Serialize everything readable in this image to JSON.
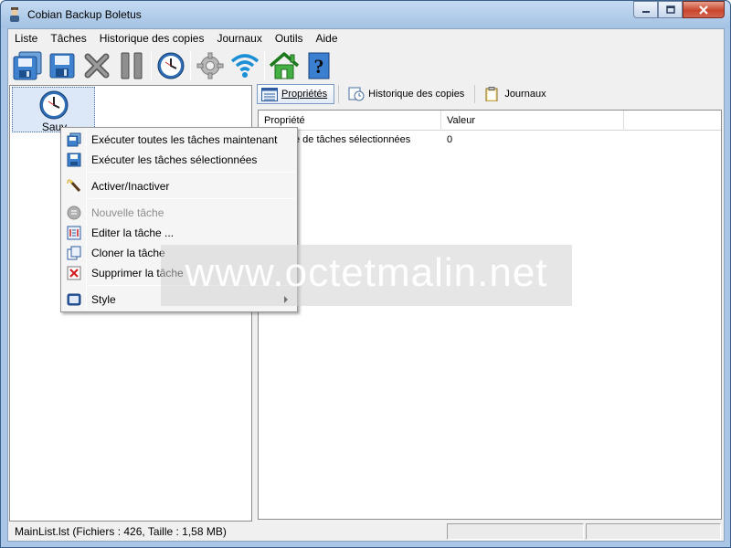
{
  "window": {
    "title": "Cobian Backup Boletus",
    "controls": [
      "minimize",
      "maximize",
      "close"
    ]
  },
  "menu": {
    "items": [
      "Liste",
      "Tâches",
      "Historique des copies",
      "Journaux",
      "Outils",
      "Aide"
    ]
  },
  "toolbar": {
    "buttons": [
      {
        "icon": "run-all-icon"
      },
      {
        "icon": "save-icon"
      },
      {
        "icon": "stop-icon"
      },
      {
        "icon": "pause-icon"
      },
      {
        "icon": "clock-icon"
      },
      {
        "icon": "settings-gear-icon"
      },
      {
        "icon": "wireless-icon"
      },
      {
        "icon": "home-icon"
      },
      {
        "icon": "help-icon"
      }
    ]
  },
  "task_list": {
    "items": [
      {
        "label": "Sauv",
        "icon": "clock-icon"
      }
    ]
  },
  "tabs": [
    {
      "label": "Propriétés",
      "icon": "properties-icon",
      "active": true
    },
    {
      "label": "Historique des copies",
      "icon": "history-icon",
      "active": false
    },
    {
      "label": "Journaux",
      "icon": "clipboard-icon",
      "active": false
    }
  ],
  "properties_table": {
    "columns": [
      "Propriété",
      "Valeur",
      ""
    ],
    "rows": [
      [
        "Nombre de tâches sélectionnées",
        "0"
      ]
    ]
  },
  "context_menu": {
    "items": [
      {
        "label": "Exécuter toutes les tâches maintenant",
        "icon": "run-all-icon",
        "disabled": false
      },
      {
        "label": "Exécuter les tâches sélectionnées",
        "icon": "run-selected-icon",
        "disabled": false
      },
      {
        "label": "Activer/Inactiver",
        "icon": "magic-wand-icon",
        "disabled": false
      },
      {
        "label": "Nouvelle tâche",
        "icon": "new-task-icon",
        "disabled": true
      },
      {
        "label": "Editer la tâche ...",
        "icon": "edit-task-icon",
        "disabled": false
      },
      {
        "label": "Cloner la tâche",
        "icon": "clone-task-icon",
        "disabled": false
      },
      {
        "label": "Supprimer la tâche",
        "icon": "delete-task-icon",
        "disabled": false
      },
      {
        "label": "Style",
        "icon": "style-icon",
        "disabled": false,
        "submenu": true
      }
    ]
  },
  "status_bar": {
    "text": "MainList.lst (Fichiers : 426, Taille : 1,58 MB)"
  },
  "watermark": {
    "text": "www.octetmalin.net"
  },
  "colors": {
    "title_bar": "#a4c2e4",
    "close_button": "#c8462d",
    "selection": "#dce8f8",
    "client_bg": "#f0f0f0"
  }
}
